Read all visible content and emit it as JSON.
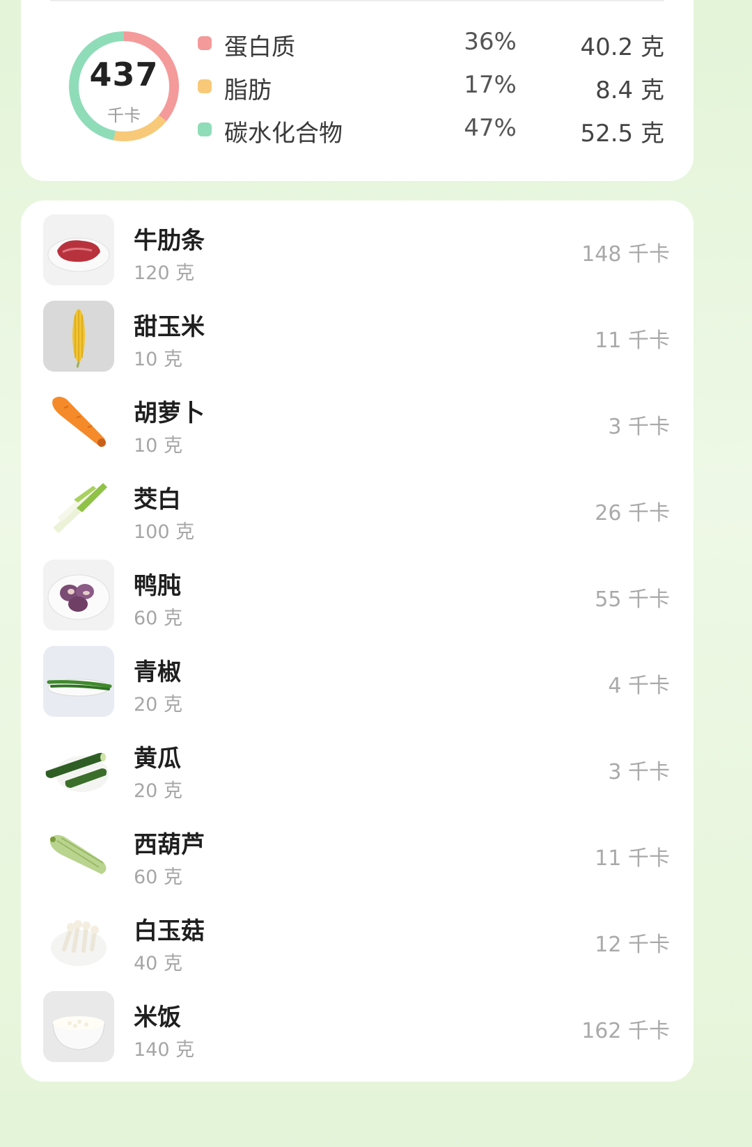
{
  "summary": {
    "total_kcal": "437",
    "kcal_unit": "千卡",
    "macros": [
      {
        "name": "蛋白质",
        "percent": "36%",
        "grams": "40.2 克",
        "color": "#f49a9a",
        "fraction": 0.36
      },
      {
        "name": "脂肪",
        "percent": "17%",
        "grams": "8.4 克",
        "color": "#f7c978",
        "fraction": 0.17
      },
      {
        "name": "碳水化合物",
        "percent": "47%",
        "grams": "52.5 克",
        "color": "#8fdcb9",
        "fraction": 0.47
      }
    ]
  },
  "foods": [
    {
      "name": "牛肋条",
      "weight": "120 克",
      "kcal": "148 千卡",
      "icon": "beef-icon"
    },
    {
      "name": "甜玉米",
      "weight": "10 克",
      "kcal": "11 千卡",
      "icon": "corn-icon"
    },
    {
      "name": "胡萝卜",
      "weight": "10 克",
      "kcal": "3 千卡",
      "icon": "carrot-icon"
    },
    {
      "name": "茭白",
      "weight": "100 克",
      "kcal": "26 千卡",
      "icon": "water-bamboo-icon"
    },
    {
      "name": "鸭肫",
      "weight": "60 克",
      "kcal": "55 千卡",
      "icon": "duck-gizzard-icon"
    },
    {
      "name": "青椒",
      "weight": "20 克",
      "kcal": "4 千卡",
      "icon": "green-pepper-icon"
    },
    {
      "name": "黄瓜",
      "weight": "20 克",
      "kcal": "3 千卡",
      "icon": "cucumber-icon"
    },
    {
      "name": "西葫芦",
      "weight": "60 克",
      "kcal": "11 千卡",
      "icon": "zucchini-icon"
    },
    {
      "name": "白玉菇",
      "weight": "40 克",
      "kcal": "12 千卡",
      "icon": "mushroom-icon"
    },
    {
      "name": "米饭",
      "weight": "140 克",
      "kcal": "162 千卡",
      "icon": "rice-icon"
    }
  ]
}
